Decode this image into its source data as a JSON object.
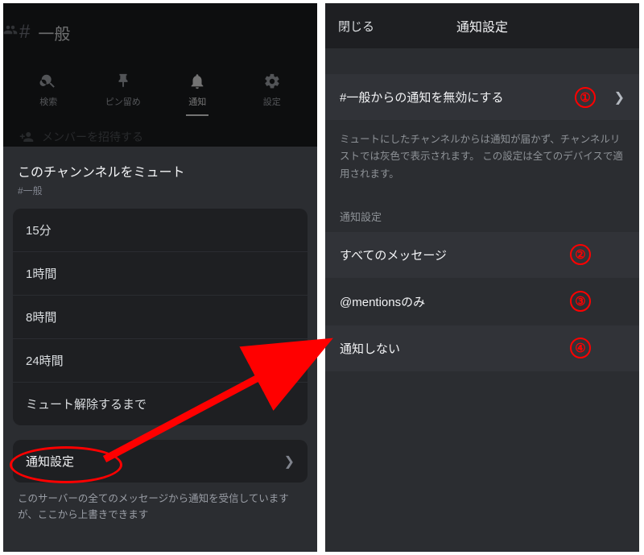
{
  "left": {
    "channel_hash": "#",
    "channel_name": "一般",
    "actions": {
      "search": "検索",
      "pin": "ピン留め",
      "notify": "通知",
      "settings": "設定"
    },
    "invite_dim": "メンバーを招待する",
    "sheet_title": "このチャンンネルをミュート",
    "sheet_sub": "#一般",
    "options": [
      "15分",
      "1時間",
      "8時間",
      "24時間",
      "ミュート解除するまで"
    ],
    "settings_label": "通知設定",
    "desc": "このサーバーの全てのメッセージから通知を受信していますが、ここから上書きできます"
  },
  "right": {
    "close": "閉じる",
    "title": "通知設定",
    "mute_label": "#一般からの通知を無効にする",
    "mute_note": "ミュートにしたチャンネルからは通知が届かず、チャンネルリストでは灰色で表示されます。 この設定は全てのデバイスで適用されます。",
    "section": "通知設定",
    "opts": [
      "すべてのメッセージ",
      "@mentionsのみ",
      "通知しない"
    ]
  },
  "badges": {
    "b1": "①",
    "b2": "②",
    "b3": "③",
    "b4": "④"
  }
}
